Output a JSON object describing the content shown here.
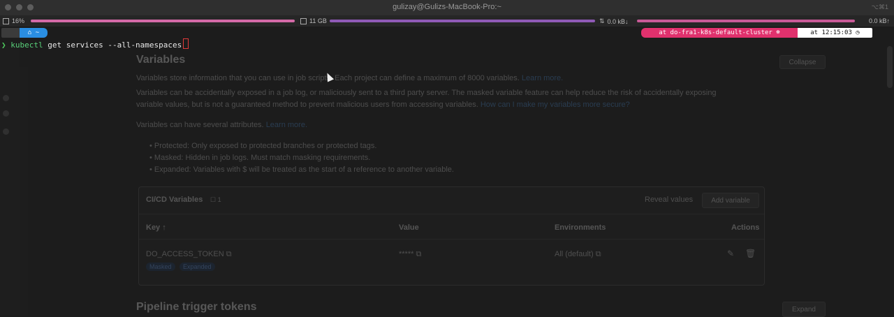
{
  "window": {
    "title": "gulizay@Gulizs-MacBook-Pro:~",
    "shortcut": "⌥⌘1"
  },
  "status": {
    "cpu": "16%",
    "memory": "11 GB",
    "net_down": "0.0 kB↓",
    "net_up": "0.0 kB↑"
  },
  "prompt": {
    "apple": "",
    "home": "~",
    "context": "at do-fra1-k8s-default-cluster ☸",
    "time": "at 12:15:03 ◷",
    "chevron": "❯",
    "command": "kubectl",
    "args": " get services --all-namespaces"
  },
  "background_page": {
    "variables_title": "Variables",
    "collapse_label": "Collapse",
    "intro_1": "Variables store information that you can use in job scripts. Each project can define a maximum of 8000 variables.",
    "learn_more_1": "Learn more.",
    "intro_2a": "Variables can be accidentally exposed in a job log, or maliciously sent to a third party server. The masked variable feature can help reduce the risk of accidentally exposing",
    "intro_2b": "variable values, but is not a guaranteed method to prevent malicious users from accessing variables.",
    "secure_link": "How can I make my variables more secure?",
    "attributes_intro": "Variables can have several attributes.",
    "learn_more_2": "Learn more.",
    "bullet_1": "•  Protected:  Only exposed to protected branches or protected tags.",
    "bullet_2": "•  Masked:  Hidden in job logs. Must match masking requirements.",
    "bullet_3": "•  Expanded:  Variables with  $  will be treated as the start of a reference to another variable.",
    "card_title": "CI/CD Variables",
    "card_count": "☐ 1",
    "reveal_label": "Reveal values",
    "add_label": "Add variable",
    "th_key": "Key ↑",
    "th_value": "Value",
    "th_env": "Environments",
    "th_actions": "Actions",
    "row_key": "DO_ACCESS_TOKEN  ⧉",
    "row_value": "*****  ⧉",
    "row_env": "All (default)  ⧉",
    "badge_masked": "Masked",
    "badge_expanded": "Expanded",
    "pipeline_title": "Pipeline trigger tokens",
    "expand_label": "Expand"
  }
}
